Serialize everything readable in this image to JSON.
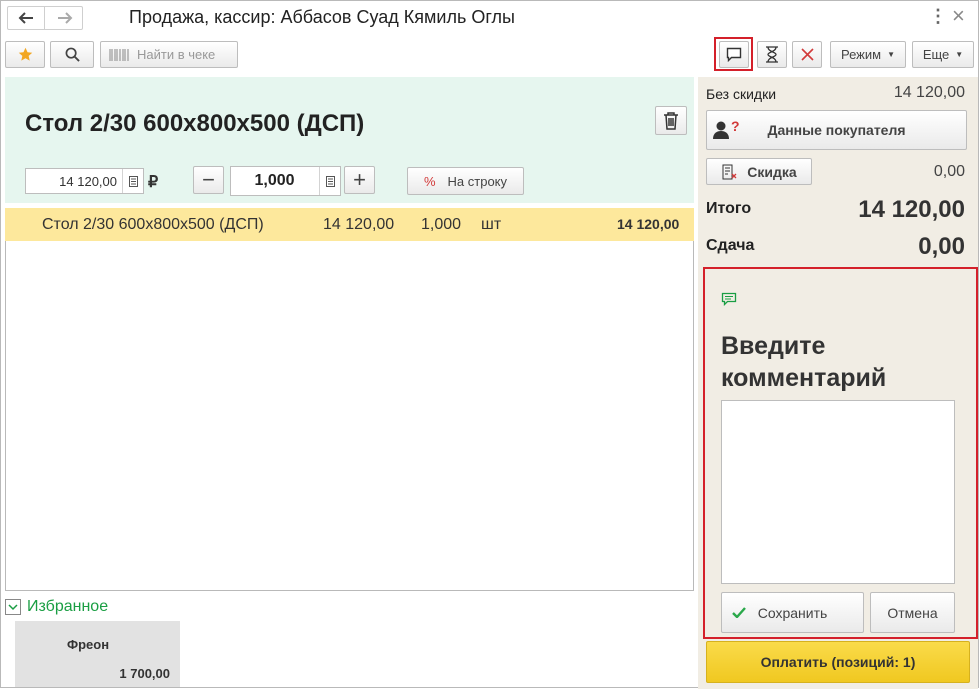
{
  "window": {
    "title": "Продажа, кассир: Аббасов Суад Кямиль Оглы",
    "more_icon": "⋮",
    "close_icon": "×"
  },
  "toolbar": {
    "search_in_receipt": "Найти в чеке",
    "mode_label": "Режим",
    "more_label": "Еще"
  },
  "product": {
    "name": "Стол 2/30 600x800x500 (ДСП)",
    "price": "14 120,00",
    "currency": "₽",
    "quantity": "1,000",
    "discount_button": "На строку"
  },
  "receipt_rows": [
    {
      "name": "Стол 2/30 600x800x500 (ДСП)",
      "price": "14 120,00",
      "quantity": "1,000",
      "unit": "шт",
      "sum": "14 120,00"
    }
  ],
  "favorites": {
    "label": "Избранное",
    "items": [
      {
        "name": "Фреон",
        "price": "1 700,00"
      }
    ]
  },
  "summary": {
    "without_discount_label": "Без скидки",
    "without_discount_value": "14 120,00",
    "customer_button": "Данные покупателя",
    "discount_button": "Скидка",
    "discount_value": "0,00",
    "total_label": "Итого",
    "total_value": "14 120,00",
    "change_label": "Сдача",
    "change_value": "0,00"
  },
  "comment": {
    "heading": "Введите комментарий",
    "text": "",
    "save_button": "Сохранить",
    "cancel_button": "Отмена"
  },
  "pay_button": "Оплатить (позиций: 1)",
  "colors": {
    "accent_teal": "#e6f6ef",
    "selected_row": "#fde89c",
    "pay_button": "#f7d22a",
    "highlight_border": "#d4202a",
    "favorites_green": "#1a9e43"
  }
}
